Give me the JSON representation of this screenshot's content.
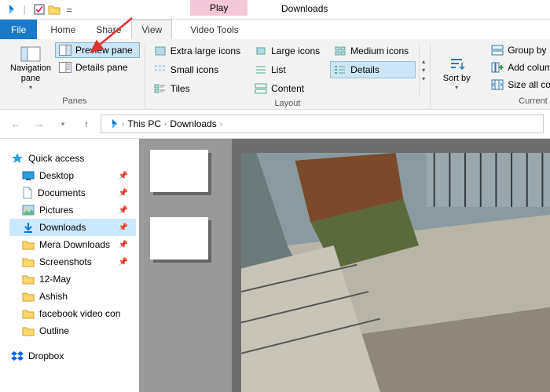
{
  "titlebar": {
    "play_tab": "Play",
    "title": "Downloads"
  },
  "tabs": {
    "file": "File",
    "home": "Home",
    "share": "Share",
    "view": "View",
    "video_tools": "Video Tools"
  },
  "ribbon": {
    "panes": {
      "navigation": "Navigation pane",
      "preview": "Preview pane",
      "details": "Details pane",
      "group": "Panes"
    },
    "layout": {
      "xl": "Extra large icons",
      "large": "Large icons",
      "medium": "Medium icons",
      "small": "Small icons",
      "list": "List",
      "details": "Details",
      "tiles": "Tiles",
      "content": "Content",
      "group": "Layout"
    },
    "sort": {
      "sortby": "Sort by",
      "group": ""
    },
    "current": {
      "groupby": "Group by",
      "addcols": "Add columns",
      "sizeall": "Size all columns to f",
      "group": "Current view"
    }
  },
  "addr": {
    "thispc": "This PC",
    "downloads": "Downloads"
  },
  "nav": {
    "quick": "Quick access",
    "desktop": "Desktop",
    "documents": "Documents",
    "pictures": "Pictures",
    "downloads": "Downloads",
    "mera": "Mera Downloads",
    "screenshots": "Screenshots",
    "may": "12-May",
    "ashish": "Ashish",
    "fb": "facebook video con",
    "outline": "Outline",
    "dropbox": "Dropbox"
  }
}
